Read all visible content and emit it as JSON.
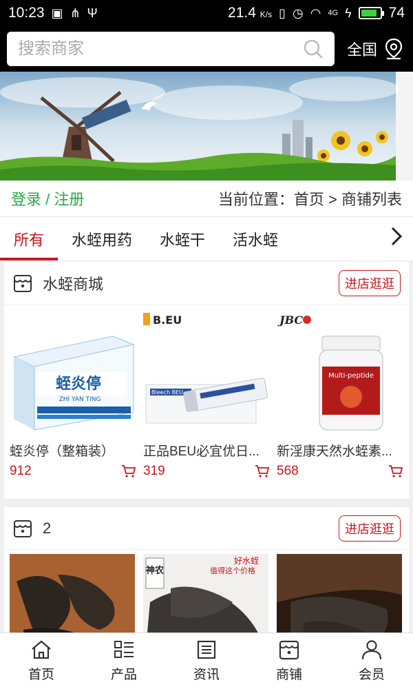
{
  "status": {
    "time": "10:23",
    "speed": "21.4",
    "speed_unit": "K/s",
    "network": "4G",
    "battery": "74"
  },
  "search": {
    "placeholder": "搜索商家",
    "region": "全国"
  },
  "location": {
    "login_text": "登录 / 注册",
    "crumb_text": "当前位置：首页 > 商铺列表"
  },
  "tabs": [
    {
      "label": "所有"
    },
    {
      "label": "水蛭用药"
    },
    {
      "label": "水蛭干"
    },
    {
      "label": "活水蛭"
    }
  ],
  "shops": [
    {
      "name": "水蛭商城",
      "visit_label": "进店逛逛",
      "products": [
        {
          "name": "蛭炎停（整箱装）",
          "price": "912",
          "box_text": "蛭炎停",
          "box_sub": "ZHI YAN TING"
        },
        {
          "name": "正品BEU必宜优日...",
          "price": "319",
          "brand": "B.EU",
          "label": "Bleech BEU"
        },
        {
          "name": "新淫康天然水蛭素...",
          "price": "568",
          "brand": "JBC",
          "label": "Multi-peptide"
        }
      ]
    },
    {
      "name": "2",
      "visit_label": "进店逛逛",
      "products": [
        {
          "name": ""
        },
        {
          "name": "",
          "tag1": "好水蛭",
          "tag2": "值得这个价格",
          "seal": "神农"
        },
        {
          "name": ""
        }
      ]
    }
  ],
  "nav": [
    {
      "label": "首页",
      "icon": "home-icon"
    },
    {
      "label": "产品",
      "icon": "list-icon"
    },
    {
      "label": "资讯",
      "icon": "news-icon"
    },
    {
      "label": "商铺",
      "icon": "shop-icon"
    },
    {
      "label": "会员",
      "icon": "user-icon"
    }
  ],
  "colors": {
    "accent": "#c8161d",
    "login": "#2aa84a",
    "bar": "#000000"
  }
}
